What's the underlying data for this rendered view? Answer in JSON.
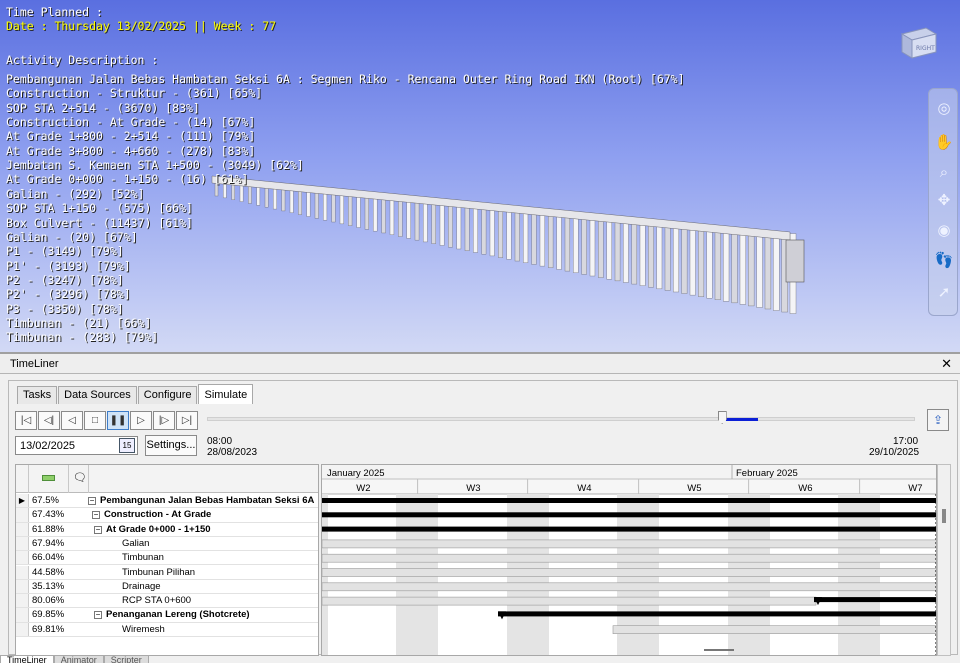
{
  "overlay": {
    "time_label": "Time Planned :",
    "date_line": "Date : Thursday 13/02/2025 || Week : 77",
    "activity_label": "Activity Description :",
    "activities": [
      "Pembangunan Jalan Bebas Hambatan Seksi 6A : Segmen Riko - Rencana Outer Ring Road IKN (Root) [67%]",
      "Construction - Struktur - (361) [65%]",
      "SOP STA 2+514 - (3670) [83%]",
      "Construction - At Grade - (14) [67%]",
      "At Grade 1+800 - 2+514 - (111) [79%]",
      "At Grade 3+800 - 4+660 - (278) [83%]",
      "Jembatan S. Kemaen STA 1+500 - (3049) [62%]",
      "At Grade 0+000 - 1+150 - (16) [61%]",
      "Galian - (292) [52%]",
      "SOP STA 1+150 - (575) [66%]",
      "Box Culvert - (11437) [61%]",
      "Galian - (20) [67%]",
      "P1 - (3149) [79%]",
      "P1' - (3193) [79%]",
      "P2 - (3247) [78%]",
      "P2' - (3296) [78%]",
      "P3 - (3350) [78%]",
      "Timbunan - (21) [66%]",
      "Timbunan - (283) [79%]"
    ],
    "viewcube_label": "RIGHT"
  },
  "colors": {
    "accent": "#0b1fd6",
    "overlay_text": "#ffffff",
    "overlay_highlight": "#ffff00",
    "bar": "#000000"
  },
  "panel": {
    "title": "TimeLiner",
    "close": "✕",
    "tabs": [
      "Tasks",
      "Data Sources",
      "Configure",
      "Simulate"
    ],
    "active_tab": "Simulate"
  },
  "controls": {
    "icons": [
      "rewind-start-icon",
      "step-back-icon",
      "play-reverse-icon",
      "stop-icon",
      "pause-icon",
      "play-icon",
      "step-forward-icon",
      "forward-end-icon"
    ],
    "date_value": "13/02/2025",
    "calendar_day": "15",
    "settings_label": "Settings...",
    "start_time": "08:00",
    "start_date": "28/08/2023",
    "end_time": "17:00",
    "end_date": "29/10/2025",
    "progress_fraction": 0.727
  },
  "grid": {
    "rows": [
      {
        "percent": "67.5%",
        "name": "Pembangunan Jalan Bebas Hambatan Seksi 6A",
        "bold": true,
        "level": 0,
        "toggle": "−",
        "current": true
      },
      {
        "percent": "67.43%",
        "name": "Construction - At Grade",
        "bold": true,
        "level": 1,
        "toggle": "−"
      },
      {
        "percent": "61.88%",
        "name": "At Grade 0+000 - 1+150",
        "bold": true,
        "level": 2,
        "toggle": "−"
      },
      {
        "percent": "67.94%",
        "name": "Galian",
        "bold": false,
        "level": 3
      },
      {
        "percent": "66.04%",
        "name": "Timbunan",
        "bold": false,
        "level": 3
      },
      {
        "percent": "44.58%",
        "name": "Timbunan Pilihan",
        "bold": false,
        "level": 3
      },
      {
        "percent": "35.13%",
        "name": "Drainage",
        "bold": false,
        "level": 3
      },
      {
        "percent": "80.06%",
        "name": "RCP STA 0+600",
        "bold": false,
        "level": 3
      },
      {
        "percent": "69.85%",
        "name": "Penanganan Lereng (Shotcrete)",
        "bold": true,
        "level": 2,
        "toggle": "−"
      },
      {
        "percent": "69.81%",
        "name": "Wiremesh",
        "bold": false,
        "level": 3
      }
    ]
  },
  "gantt": {
    "months": [
      "January 2025",
      "February 2025"
    ],
    "weeks": [
      "W2",
      "W3",
      "W4",
      "W5",
      "W6",
      "W7"
    ]
  },
  "bottom_tabs": [
    "TimeLiner",
    "Animator",
    "Scripter"
  ]
}
